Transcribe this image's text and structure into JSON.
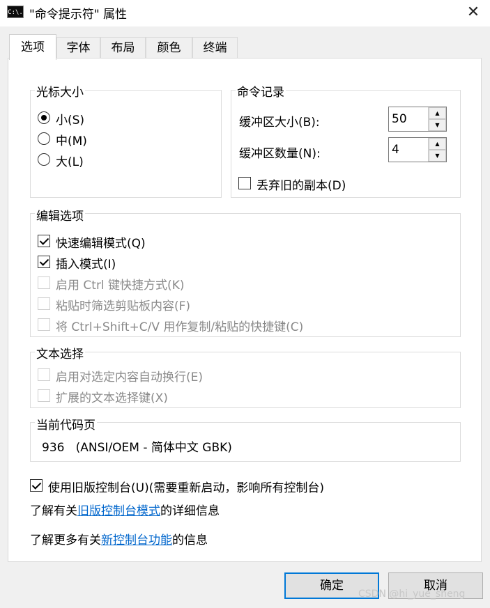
{
  "window": {
    "title": "\"命令提示符\" 属性",
    "icon_text": "C:\\."
  },
  "tabs": [
    {
      "label": "选项",
      "active": true
    },
    {
      "label": "字体",
      "active": false
    },
    {
      "label": "布局",
      "active": false
    },
    {
      "label": "颜色",
      "active": false
    },
    {
      "label": "终端",
      "active": false
    }
  ],
  "cursor_size": {
    "title": "光标大小",
    "options": [
      {
        "label": "小(S)",
        "selected": true
      },
      {
        "label": "中(M)",
        "selected": false
      },
      {
        "label": "大(L)",
        "selected": false
      }
    ]
  },
  "command_history": {
    "title": "命令记录",
    "buffer_size_label": "缓冲区大小(B):",
    "buffer_size_value": "50",
    "buffer_count_label": "缓冲区数量(N):",
    "buffer_count_value": "4",
    "discard_label": "丢弃旧的副本(D)",
    "discard_checked": false
  },
  "edit_options": {
    "title": "编辑选项",
    "items": [
      {
        "label": "快速编辑模式(Q)",
        "checked": true,
        "enabled": true
      },
      {
        "label": "插入模式(I)",
        "checked": true,
        "enabled": true
      },
      {
        "label": "启用 Ctrl 键快捷方式(K)",
        "checked": false,
        "enabled": false
      },
      {
        "label": "粘贴时筛选剪贴板内容(F)",
        "checked": false,
        "enabled": false
      },
      {
        "label": "将 Ctrl+Shift+C/V 用作复制/粘贴的快捷键(C)",
        "checked": false,
        "enabled": false
      }
    ]
  },
  "text_selection": {
    "title": "文本选择",
    "items": [
      {
        "label": "启用对选定内容自动换行(E)",
        "checked": false,
        "enabled": false
      },
      {
        "label": "扩展的文本选择键(X)",
        "checked": false,
        "enabled": false
      }
    ]
  },
  "code_page": {
    "title": "当前代码页",
    "value": "936   (ANSI/OEM - 简体中文 GBK)"
  },
  "legacy_console": {
    "label": "使用旧版控制台(U)(需要重新启动，影响所有控制台)",
    "checked": true
  },
  "info1": {
    "prefix": "了解有关",
    "link": "旧版控制台模式",
    "suffix": "的详细信息"
  },
  "info2": {
    "prefix": "了解更多有关",
    "link": "新控制台功能",
    "suffix": "的信息"
  },
  "buttons": {
    "ok": "确定",
    "cancel": "取消"
  },
  "watermark": "CSDN @hi_yue_sheng",
  "colors": {
    "link": "#0066cc",
    "primary_border": "#0078d7",
    "disabled_text": "#8a8a8a"
  }
}
